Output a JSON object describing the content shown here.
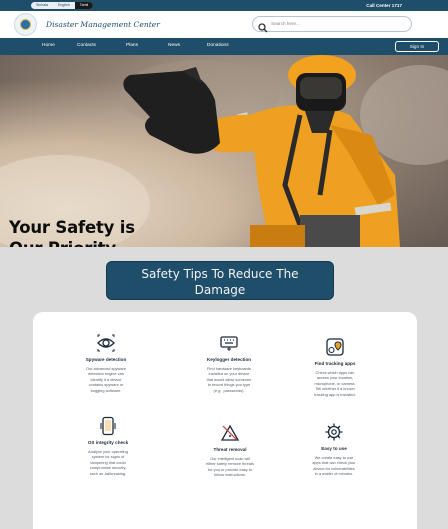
{
  "topbar": {
    "languages": [
      "Sinhala",
      "English",
      "Tamil"
    ],
    "active_language": "Tamil",
    "call_center": "Call Center 1717"
  },
  "header": {
    "title": "Disaster Management Center",
    "search_placeholder": "Search here..."
  },
  "nav": {
    "items": [
      "Home",
      "Contacts",
      "Plans",
      "News",
      "Donations"
    ],
    "signin_label": "Sign In"
  },
  "hero": {
    "line1": "Your Safety is",
    "line2": "Our Priority"
  },
  "tips": {
    "title_line1": "Safety Tips To Reduce The",
    "title_line2": "Damage"
  },
  "features": [
    {
      "icon": "eye-icon",
      "title": "Spyware detection",
      "desc": [
        "Our advanced spyware",
        "detection engine can",
        "identify if a device",
        "contains spyware or",
        "bugging software."
      ]
    },
    {
      "icon": "keyboard-icon",
      "title": "Keylogger detection",
      "desc": [
        "Find hardware keyboards",
        "installed on your device",
        "that would allow someone",
        "to record things you type",
        "(e.g., passwords)."
      ]
    },
    {
      "icon": "location-app-icon",
      "title": "Find tracking apps",
      "desc": [
        "Check which apps can",
        "access your location,",
        "microphone, or camera.",
        "Tell whether if a known",
        "tracking app is installed."
      ]
    },
    {
      "icon": "phone-check-icon",
      "title": "OS integrity check",
      "desc": [
        "Analyze your operating",
        "system for signs of",
        "tampering that could",
        "compromise security,",
        "such as Jailbreaking."
      ]
    },
    {
      "icon": "warning-remove-icon",
      "title": "Threat removal",
      "desc": [
        "Our intelligent scan will",
        "either safely remove threats",
        "for you or provide easy to",
        "follow instructions."
      ]
    },
    {
      "icon": "gear-icon",
      "title": "Easy to use",
      "desc": [
        "We create easy to use",
        "apps that can check your",
        "device for vulnerabilities",
        "in a matter of minutes."
      ]
    }
  ],
  "colors": {
    "primary": "#1f4e6b",
    "background": "#dcdcdc",
    "suit": "#f0a020"
  }
}
